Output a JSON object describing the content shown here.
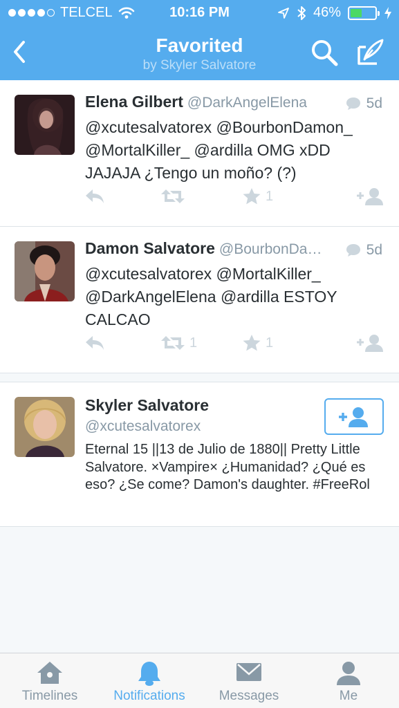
{
  "status_bar": {
    "carrier": "TELCEL",
    "time": "10:16 PM",
    "battery": "46%",
    "battery_level": 0.46
  },
  "nav": {
    "title": "Favorited",
    "subtitle": "by Skyler Salvatore"
  },
  "tweets": [
    {
      "name": "Elena Gilbert",
      "handle": "@DarkAngelElena",
      "time": "5d",
      "text": "@xcutesalvatorex @BourbonDamon_ @MortalKiller_ @ardilla OMG xDD JAJAJA ¿Tengo un moño? (?)",
      "retweets": "",
      "favorites": "1"
    },
    {
      "name": "Damon Salvatore",
      "handle": "@BourbonDa…",
      "time": "5d",
      "text": "@xcutesalvatorex @MortalKiller_ @DarkAngelElena @ardilla ESTOY CALCAO",
      "retweets": "1",
      "favorites": "1"
    }
  ],
  "profile": {
    "name": "Skyler Salvatore",
    "handle": "@xcutesalvatorex",
    "bio": "Eternal 15 ||13 de Julio de 1880|| Pretty Little Salvatore. ×Vampire× ¿Humanidad? ¿Qué es eso? ¿Se come? Damon's daughter. #FreeRol"
  },
  "tabs": [
    {
      "label": "Timelines",
      "icon": "home-icon",
      "active": false
    },
    {
      "label": "Notifications",
      "icon": "bell-icon",
      "active": true
    },
    {
      "label": "Messages",
      "icon": "envelope-icon",
      "active": false
    },
    {
      "label": "Me",
      "icon": "person-icon",
      "active": false
    }
  ],
  "colors": {
    "brand": "#55acee",
    "action_gray": "#ccd6dd",
    "meta_gray": "#8899a6",
    "battery_green": "#4cd964"
  }
}
